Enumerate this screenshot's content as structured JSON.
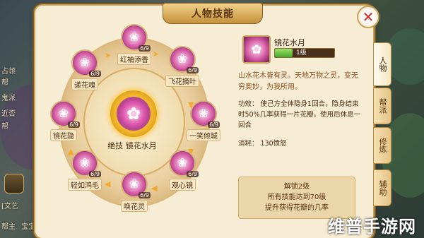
{
  "panel": {
    "title": "人物技能"
  },
  "hud": {
    "lines": [
      "占领",
      "帮",
      "鬼派",
      "近否",
      "帮",
      "[文艺",
      "帮主",
      "宝宝"
    ]
  },
  "center_skill": {
    "label": "绝技  镜花水月",
    "icon": "lotus-icon"
  },
  "skills": [
    {
      "name": "红袖添香",
      "level": "6/9"
    },
    {
      "name": "飞花摘叶",
      "level": "6/9"
    },
    {
      "name": "一笑倾城",
      "level": "6/9"
    },
    {
      "name": "观心镜",
      "level": "6/9"
    },
    {
      "name": "唤花灵",
      "level": "6/9"
    },
    {
      "name": "轻如鸿毛",
      "level": "6/9"
    },
    {
      "name": "镜花隐",
      "level": "6/9"
    },
    {
      "name": "递花魂",
      "level": "6/9"
    }
  ],
  "detail": {
    "name": "镜花水月",
    "level_text": "1级",
    "level_fraction": 0.3,
    "description": "山水花木皆有灵。天地万物之灵，变无穷奥妙，为我所用。",
    "effect": "功效：  使己方全体隐身1回合，隐身结束时50%几率获得一片花瓣。使用后休息一回合",
    "cost": "消耗：    130愤怒",
    "unlock_line1": "解锁2级",
    "unlock_line2": "所有技能达到70级",
    "unlock_line3": "提升获得花瓣的几率"
  },
  "tabs": [
    "人物",
    "帮派",
    "修炼",
    "辅助"
  ],
  "watermark": "维普手游网",
  "colors": {
    "accent": "#c9a25a",
    "title_text": "#5a3410",
    "close": "#c8231f",
    "level_bar": "#46a82a"
  }
}
